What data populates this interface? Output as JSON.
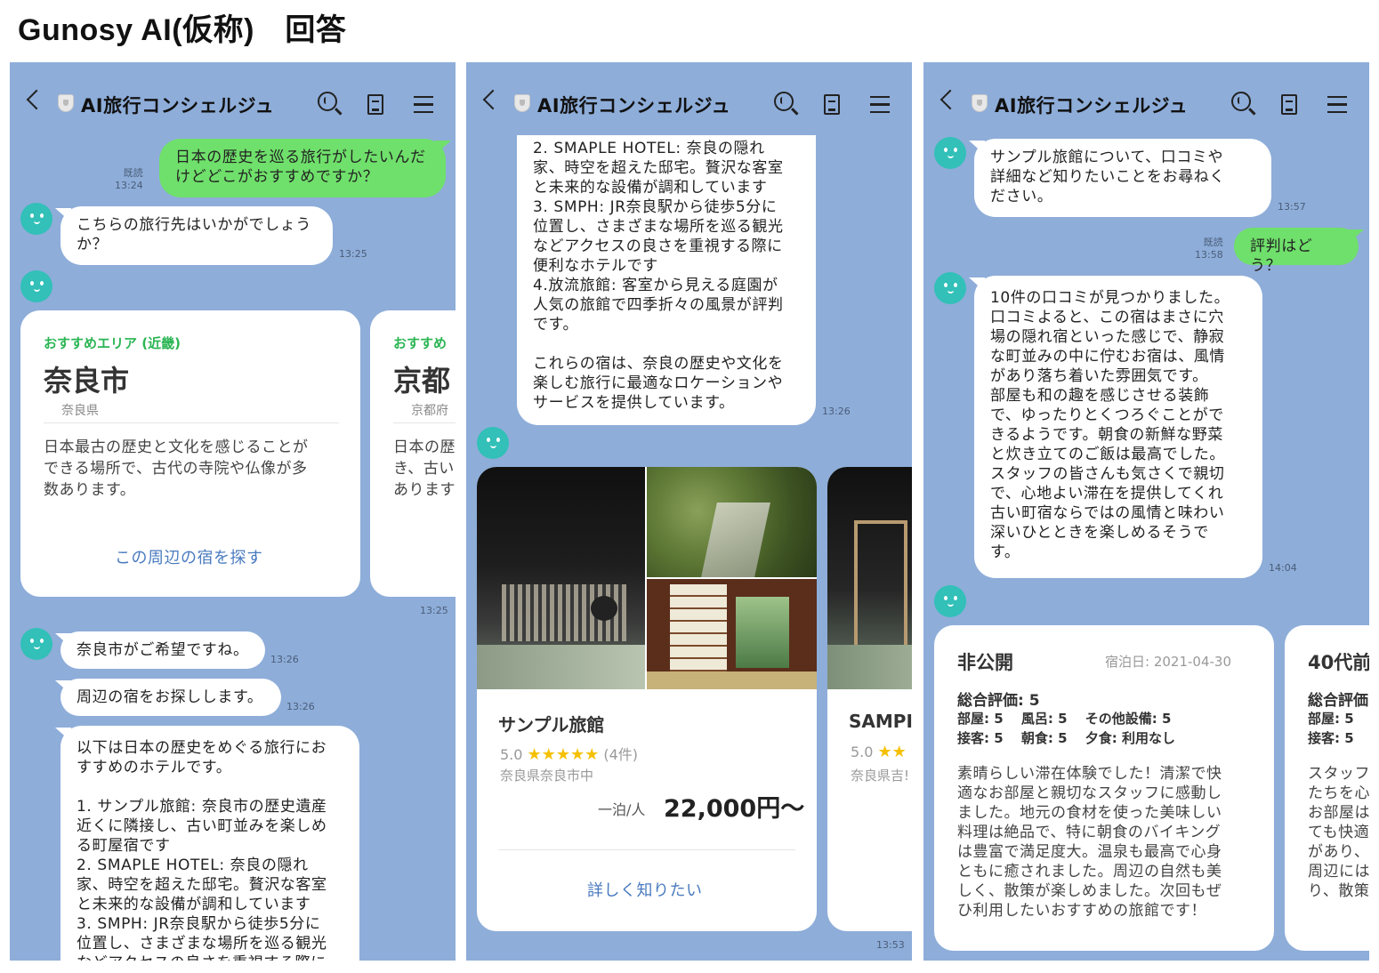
{
  "page_title": "Gunosy AI(仮称)　回答",
  "header": {
    "title": "AI旅行コンシェルジュ"
  },
  "colors": {
    "chat_bg": "#8eadd9",
    "user_bubble": "#6fe06b",
    "bot_avatar": "#32c0b8",
    "area_label": "#2bb553",
    "link": "#4a7bbf",
    "star": "#f5c000"
  },
  "screen1": {
    "user_msg": "日本の歴史を巡る旅行がしたいんだ\nけどどこがおすすめですか？",
    "read_label": "既読",
    "user_time": "13:24",
    "bot_msg1": "こちらの旅行先はいかがでしょう\nか？",
    "bot_time1": "13:25",
    "cards": [
      {
        "label": "おすすめエリア (近畿)",
        "name": "奈良市",
        "pref": "奈良県",
        "desc": "日本最古の歴史と文化を感じることが\nできる場所で、古代の寺院や仏像が多\n数あります。",
        "link": "この周辺の宿を探す"
      },
      {
        "label": "おすすめ",
        "name": "京都",
        "pref": "京都府",
        "desc": "日本の歴\nき、古い\nあります"
      }
    ],
    "cards_time": "13:25",
    "bot_msg2": "奈良市がご希望ですね。",
    "bot_time2": "13:26",
    "bot_msg3": "周辺の宿をお探しします。",
    "bot_time3": "13:26",
    "bot_msg4": "以下は日本の歴史をめぐる旅行にお\nすすめのホテルです。\n\n1. サンプル旅館: 奈良市の歴史遺産\n近くに隣接し、古い町並みを楽しめ\nる町屋宿です\n2. SMAPLE HOTEL: 奈良の隠れ\n家、時空を超えた邸宅。贅沢な客室\nと未来的な設備が調和しています\n3. SMPH: JR奈良駅から徒歩5分に\n位置し、さまざまな場所を巡る観光\nなどアクセスの良さを重視する際に"
  },
  "screen2": {
    "bot_msg": "2. SMAPLE HOTEL: 奈良の隠れ\n家、時空を超えた邸宅。贅沢な客室\nと未来的な設備が調和しています\n3. SMPH: JR奈良駅から徒歩5分に\n位置し、さまざまな場所を巡る観光\nなどアクセスの良さを重視する際に\n便利なホテルです\n4.放流旅館: 客室から見える庭園が\n人気の旅館で四季折々の風景が評判\nです。\n\nこれらの宿は、奈良の歴史や文化を\n楽しむ旅行に最適なロケーションや\nサービスを提供しています。",
    "bot_time": "13:26",
    "hotels": [
      {
        "name": "サンプル旅館",
        "rating": "5.0",
        "stars": "★★★★★",
        "count": "(4件)",
        "location": "奈良県奈良市中",
        "unit": "一泊/人",
        "price": "22,000円～",
        "link": "詳しく知りたい"
      },
      {
        "name": "SAMPI",
        "rating": "5.0",
        "stars": "★★",
        "location": "奈良県吉!"
      }
    ],
    "hotels_time": "13:53"
  },
  "screen3": {
    "bot_msg1": "サンプル旅館について、口コミや\n詳細など知りたいことをお尋ねく\nださい。",
    "bot_time1": "13:57",
    "read_label": "既読",
    "user_time": "13:58",
    "user_msg": "評判はどう？",
    "bot_msg2": "10件の口コミが見つかりました。\n口コミよると、この宿はまさに穴\n場の隠れ宿といった感じで、静寂\nな町並みの中に佇むお宿は、風情\nがあり落ち着いた雰囲気です。\n部屋も和の趣を感じさせる装飾\nで、ゆったりとくつろぐことがで\nきるようです。朝食の新鮮な野菜\nと炊き立てのご飯は最高でした。\nスタッフの皆さんも気さくで親切\nで、心地よい滞在を提供してくれ\n古い町宿ならではの風情と味わい\n深いひとときを楽しめるそうで\nす。",
    "bot_time2": "14:04",
    "reviews": [
      {
        "title": "非公開",
        "date": "宿泊日: 2021-04-30",
        "overall": "総合評価: 5",
        "line1": "部屋: 5　 風呂: 5　 その他設備: 5",
        "line2": "接客: 5　 朝食: 5　 夕食: 利用なし",
        "text": "素晴らしい滞在体験でした！清潔で快\n適なお部屋と親切なスタッフに感動し\nました。地元の食材を使った美味しい\n料理は絶品で、特に朝食のバイキング\nは豊富で満足度大。温泉も最高で心身\nともに癒されました。周辺の自然も美\nしく、散策が楽しめました。次回もぜ\nひ利用したいおすすめの旅館です！"
      },
      {
        "title": "40代前",
        "overall": "総合評価",
        "line1": "部屋: 5",
        "line2": "接客: 5",
        "text": "スタッフ\nたちを心\nお部屋は\nても快適\nがあり、\n周辺には\nり、散策"
      }
    ]
  }
}
